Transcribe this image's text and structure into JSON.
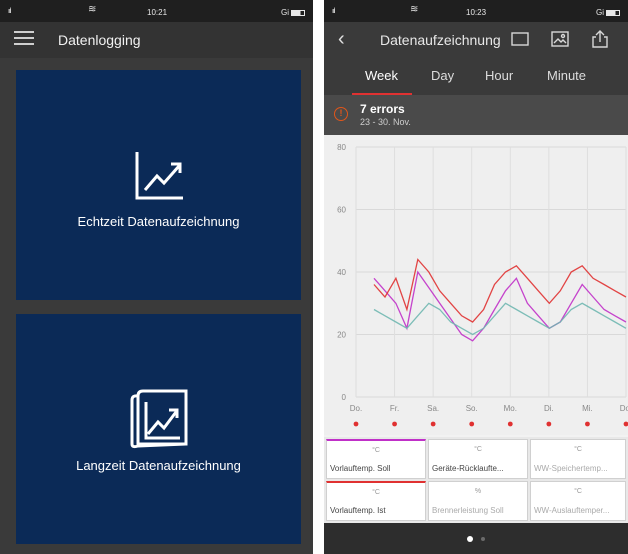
{
  "left": {
    "status": {
      "time": "10:21",
      "signal": "ııl",
      "carrier": "Gi"
    },
    "nav": {
      "title": "Datenlogging"
    },
    "tiles": [
      {
        "label": "Echtzeit Datenaufzeichnung",
        "icon": "chart-line-icon"
      },
      {
        "label": "Langzeit Datenaufzeichnung",
        "icon": "chart-scroll-icon"
      }
    ]
  },
  "right": {
    "status": {
      "time": "10:23",
      "signal": "ııl",
      "carrier": "Gi"
    },
    "nav": {
      "title": "Datenaufzeichnung"
    },
    "tabs": [
      "Week",
      "Day",
      "Hour",
      "Minute"
    ],
    "active_tab": "Week",
    "errors": {
      "title": "7 errors",
      "range": "23 - 30. Nov."
    },
    "chart_data": {
      "type": "line",
      "x_ticks": [
        "Do.",
        "Fr.",
        "Sa.",
        "So.",
        "Mo.",
        "Di.",
        "Mi.",
        "Do."
      ],
      "y_ticks": [
        "80",
        "60",
        "40",
        "20",
        "0"
      ],
      "ylim": [
        0,
        80
      ],
      "grid": true,
      "series": [
        {
          "color": "#c030c8",
          "values": [
            38,
            34,
            30,
            22,
            40,
            35,
            30,
            25,
            20,
            18,
            22,
            28,
            34,
            38,
            30,
            26,
            22,
            24,
            30,
            36,
            32,
            28,
            26,
            24
          ]
        },
        {
          "color": "#e03131",
          "values": [
            36,
            32,
            38,
            28,
            44,
            40,
            34,
            30,
            26,
            24,
            28,
            36,
            40,
            42,
            38,
            34,
            30,
            34,
            40,
            42,
            38,
            36,
            34,
            32
          ]
        },
        {
          "color": "#6fb7b0",
          "values": [
            28,
            26,
            24,
            22,
            26,
            30,
            28,
            24,
            22,
            20,
            22,
            26,
            30,
            28,
            26,
            24,
            22,
            24,
            28,
            30,
            28,
            26,
            24,
            22
          ]
        }
      ]
    },
    "legend": [
      {
        "unit": "°C",
        "name": "Vorlauftemp. Soll",
        "faded": false,
        "color": "#c030c8"
      },
      {
        "unit": "°C",
        "name": "Geräte-Rücklaufte...",
        "faded": false,
        "color": ""
      },
      {
        "unit": "°C",
        "name": "WW-Speichertemp...",
        "faded": true,
        "color": ""
      },
      {
        "unit": "°C",
        "name": "Vorlauftemp. Ist",
        "faded": false,
        "color": "#e03131"
      },
      {
        "unit": "%",
        "name": "Brennerleistung Soll",
        "faded": true,
        "color": ""
      },
      {
        "unit": "°C",
        "name": "WW-Auslauftemper...",
        "faded": true,
        "color": ""
      }
    ]
  }
}
